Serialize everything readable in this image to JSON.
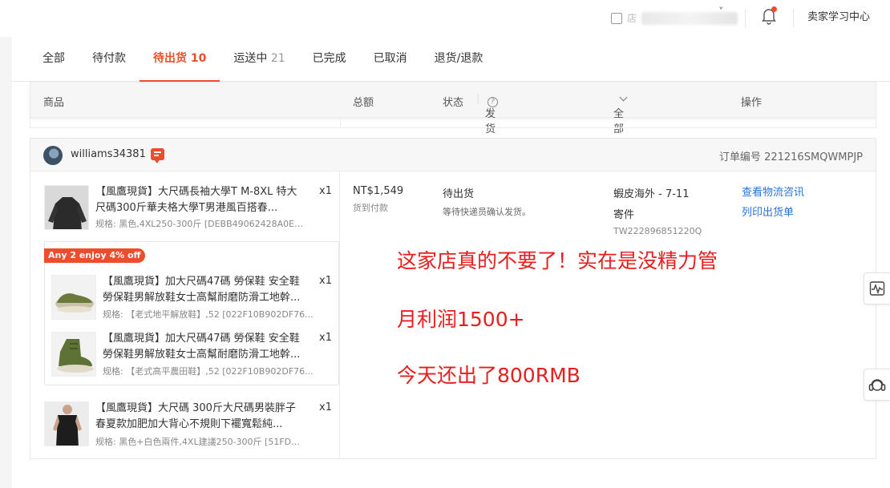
{
  "topbar": {
    "shop_label": "店",
    "seller_center": "卖家学习中心"
  },
  "tabs": [
    {
      "label": "全部",
      "count": ""
    },
    {
      "label": "待付款",
      "count": ""
    },
    {
      "label": "待出货",
      "count": "10"
    },
    {
      "label": "运送中",
      "count": "21"
    },
    {
      "label": "已完成",
      "count": ""
    },
    {
      "label": "已取消",
      "count": ""
    },
    {
      "label": "退货/退款",
      "count": ""
    }
  ],
  "active_tab": "待出货",
  "table_header": {
    "product": "商品",
    "total": "总额",
    "status": "状态",
    "ship_deadline": "发货时限",
    "logistics_filter": "全部物流渠道",
    "action": "操作"
  },
  "order": {
    "buyer": "williams34381",
    "order_no_label": "订单编号",
    "order_no": "221216SMQWMPJP",
    "total": "NT$1,549",
    "payment": "货到付款",
    "status": "待出货",
    "status_sub": "等待快递员确认发货。",
    "channel": "蝦皮海外 - 7-11",
    "ship_mode": "寄件",
    "tracking": "TW222896851220Q",
    "actions": [
      "查看物流咨讯",
      "列印出货单"
    ],
    "promo_tag": "Any 2 enjoy 4% off",
    "items": [
      {
        "name": "【風鷹現貨】大尺碼長袖大學T M-8XL 特大尺碼300斤華夫格大學T男港風百搭春...",
        "spec": "规格: 黑色,4XL250-300斤 [DEBB49062428A0EE...",
        "qty": "x1"
      },
      {
        "name": "【風鷹現貨】加大尺碼47碼 勞保鞋 安全鞋 勞保鞋男解放鞋女士高幫耐磨防滑工地幹...",
        "spec": "规格: 【老式地平解放鞋】,52 [022F10B902DF76...",
        "qty": "x1"
      },
      {
        "name": "【風鷹現貨】加大尺碼47碼 勞保鞋 安全鞋 勞保鞋男解放鞋女士高幫耐磨防滑工地幹...",
        "spec": "规格: 【老式高平農田鞋】,52 [022F10B902DF76...",
        "qty": "x1"
      },
      {
        "name": "【風鷹現貨】大尺碼 300斤大尺碼男裝胖子春夏款加肥加大背心不規則下襬寬鬆純...",
        "spec": "规格: 黑色+白色兩件,4XL建議250-300斤 [51FDB...",
        "qty": "x1"
      }
    ]
  },
  "overlay_text": [
    "这家店真的不要了！实在是没精力管",
    "月利润1500+",
    "今天还出了800RMB"
  ],
  "colors": {
    "accent": "#ee4d2d",
    "link": "#2673dd",
    "overlay": "#e81e1e"
  }
}
